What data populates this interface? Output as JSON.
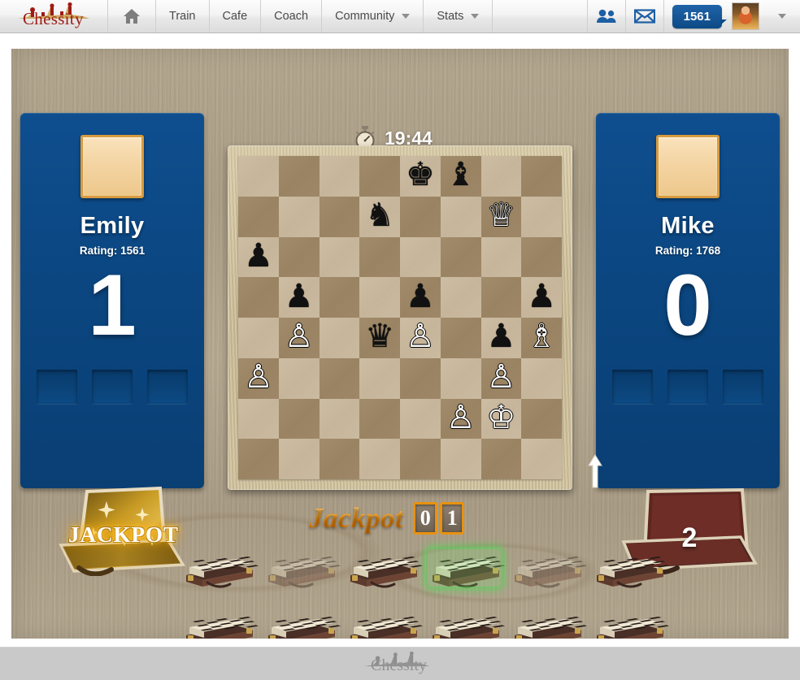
{
  "nav": {
    "brand": "Chessity",
    "home_icon": "home-icon",
    "items": [
      {
        "label": "Train",
        "has_caret": false
      },
      {
        "label": "Cafe",
        "has_caret": false
      },
      {
        "label": "Coach",
        "has_caret": false
      },
      {
        "label": "Community",
        "has_caret": true
      },
      {
        "label": "Stats",
        "has_caret": true
      }
    ],
    "friends_icon": "friends-icon",
    "mail_icon": "mail-icon",
    "rating": "1561",
    "avatar": "user-avatar",
    "account_caret": "chevron-down-icon"
  },
  "timer": {
    "icon": "stopwatch-icon",
    "value": "19:44"
  },
  "players": [
    {
      "name": "Emily",
      "rating_label": "Rating: 1561",
      "score": "1",
      "slots": 3,
      "case_state": "jackpot",
      "case_label": "JACKPOT"
    },
    {
      "name": "Mike",
      "rating_label": "Rating: 1768",
      "score": "0",
      "slots": 3,
      "case_state": "open",
      "case_label": "2"
    }
  ],
  "board": {
    "orientation": "white-bottom",
    "turn_indicator": "up-arrow-icon",
    "ranks": [
      [
        "",
        "",
        "",
        "",
        "bk",
        "bb",
        "",
        ""
      ],
      [
        "",
        "",
        "",
        "bn",
        "",
        "",
        "wq",
        ""
      ],
      [
        "bp",
        "",
        "",
        "",
        "",
        "",
        "",
        ""
      ],
      [
        "",
        "bp",
        "",
        "",
        "bp",
        "",
        "",
        "bp"
      ],
      [
        "",
        "wp",
        "",
        "bq",
        "wp",
        "",
        "bp",
        "wb"
      ],
      [
        "wp",
        "",
        "",
        "",
        "",
        "",
        "wp",
        ""
      ],
      [
        "",
        "",
        "",
        "",
        "",
        "wp",
        "wk",
        ""
      ],
      [
        "",
        "",
        "",
        "",
        "",
        "",
        "",
        ""
      ]
    ],
    "glyphs": {
      "wk": "♔",
      "wq": "♕",
      "wr": "♖",
      "wb": "♗",
      "wn": "♘",
      "wp": "♙",
      "bk": "♚",
      "bq": "♛",
      "br": "♜",
      "bb": "♝",
      "bn": "♞",
      "bp": "♟"
    }
  },
  "jackpot": {
    "label": "Jackpot",
    "digits": [
      "0",
      "1"
    ]
  },
  "cases": {
    "rows": [
      [
        {
          "state": "closed"
        },
        {
          "state": "taken"
        },
        {
          "state": "closed"
        },
        {
          "state": "selected"
        },
        {
          "state": "taken"
        },
        {
          "state": "closed"
        }
      ],
      [
        {
          "state": "closed"
        },
        {
          "state": "closed"
        },
        {
          "state": "closed"
        },
        {
          "state": "closed"
        },
        {
          "state": "closed"
        },
        {
          "state": "closed"
        }
      ]
    ]
  },
  "footer": {
    "brand": "Chessity"
  },
  "colors": {
    "panel_blue": "#0b4782",
    "board_light": "#cabaa0",
    "board_dark": "#9a8362",
    "jackpot_orange": "#f08a0c",
    "brand_red": "#9e1b16",
    "wood_bg": "#b0a38c",
    "select_green": "#5ad25a"
  }
}
